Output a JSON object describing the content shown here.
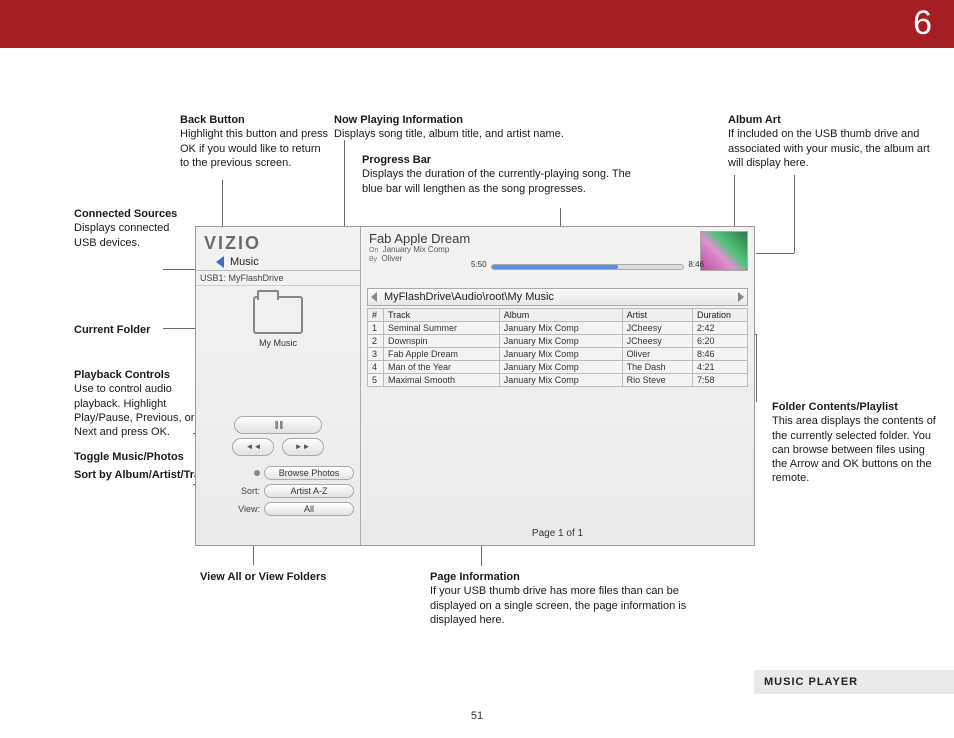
{
  "chapter": "6",
  "page_number": "51",
  "section_label": "MUSIC PLAYER",
  "annotations": {
    "back": {
      "title": "Back Button",
      "body": "Highlight this button and press OK if you would like to return to the previous screen."
    },
    "now_playing": {
      "title": "Now Playing Information",
      "body": "Displays song title, album title, and artist name."
    },
    "progress": {
      "title": "Progress Bar",
      "body": "Displays the duration of the currently-playing song. The blue bar will lengthen as the song progresses."
    },
    "album_art": {
      "title": "Album Art",
      "body": "If included on the USB thumb drive and associated with your music, the album art will display here."
    },
    "connected": {
      "title": "Connected Sources",
      "body": "Displays connected USB devices."
    },
    "current_folder": {
      "title": "Current Folder"
    },
    "playback": {
      "title": "Playback Controls",
      "body": "Use to control audio playback. Highlight Play/Pause, Previous, or Next and press OK."
    },
    "toggle": {
      "title": "Toggle Music/Photos"
    },
    "sort": {
      "title": "Sort by Album/Artist/Track"
    },
    "view": {
      "title": "View All or View Folders"
    },
    "page_info": {
      "title": "Page Information",
      "body": "If your USB thumb drive has more files than can be displayed on a single screen, the page information is displayed here."
    },
    "folder_contents": {
      "title": "Folder Contents/Playlist",
      "body": "This area displays the contents of the currently selected folder. You can browse between files using the Arrow and OK buttons on the remote."
    }
  },
  "device": {
    "brand": "VIZIO",
    "back_label": "Music",
    "usb_source": "USB1: MyFlashDrive",
    "folder_name": "My Music",
    "browse_label": "Browse Photos",
    "sort_label_prefix": "Sort:",
    "sort_value": "Artist A-Z",
    "view_label_prefix": "View:",
    "view_value": "All",
    "now_playing": {
      "title": "Fab Apple Dream",
      "on_prefix": "On",
      "album": "January Mix Comp",
      "by_prefix": "By",
      "artist": "Oliver",
      "elapsed": "5:50",
      "total": "8:46"
    },
    "breadcrumb": "MyFlashDrive\\Audio\\root\\My Music",
    "columns": {
      "num": "#",
      "track": "Track",
      "album": "Album",
      "artist": "Artist",
      "duration": "Duration"
    },
    "tracks": [
      {
        "n": "1",
        "track": "Seminal Summer",
        "album": "January Mix Comp",
        "artist": "JCheesy",
        "dur": "2:42"
      },
      {
        "n": "2",
        "track": "Downspin",
        "album": "January Mix Comp",
        "artist": "JCheesy",
        "dur": "6:20"
      },
      {
        "n": "3",
        "track": "Fab Apple Dream",
        "album": "January Mix Comp",
        "artist": "Oliver",
        "dur": "8:46"
      },
      {
        "n": "4",
        "track": "Man of the Year",
        "album": "January Mix Comp",
        "artist": "The Dash",
        "dur": "4:21"
      },
      {
        "n": "5",
        "track": "Maximal Smooth",
        "album": "January Mix Comp",
        "artist": "Rio Steve",
        "dur": "7:58"
      }
    ],
    "page_info": "Page 1 of 1"
  }
}
